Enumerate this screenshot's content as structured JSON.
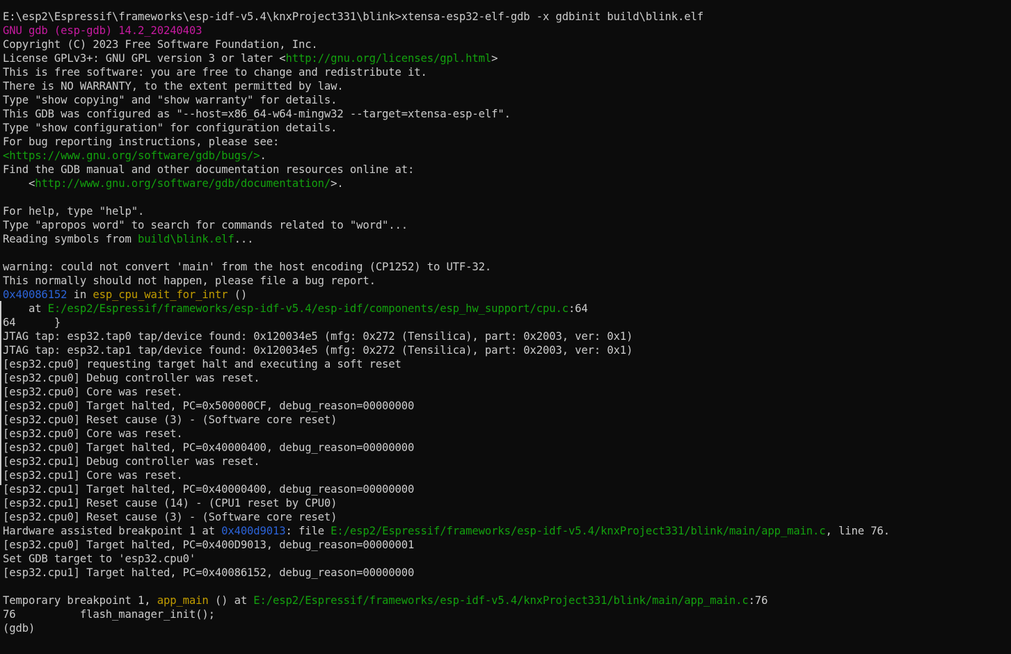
{
  "terminal": {
    "colors": {
      "background": "#0c0c0c",
      "default": "#cccccc",
      "magenta": "#c71aa0",
      "green": "#13a10e",
      "yellow": "#c19c00",
      "blue": "#2b63d8"
    },
    "lines": [
      [
        {
          "t": "E:\\esp2\\Espressif\\frameworks\\esp-idf-v5.4\\knxProject331\\blink>xtensa-esp32-elf-gdb -x gdbinit build\\blink.elf",
          "c": "default"
        }
      ],
      [
        {
          "t": "GNU gdb (esp-gdb) 14.2_20240403",
          "c": "magenta"
        }
      ],
      [
        {
          "t": "Copyright (C) 2023 Free Software Foundation, Inc.",
          "c": "default"
        }
      ],
      [
        {
          "t": "License GPLv3+: GNU GPL version 3 or later <",
          "c": "default"
        },
        {
          "t": "http://gnu.org/licenses/gpl.html",
          "c": "green"
        },
        {
          "t": ">",
          "c": "default"
        }
      ],
      [
        {
          "t": "This is free software: you are free to change and redistribute it.",
          "c": "default"
        }
      ],
      [
        {
          "t": "There is NO WARRANTY, to the extent permitted by law.",
          "c": "default"
        }
      ],
      [
        {
          "t": "Type \"show copying\" and \"show warranty\" for details.",
          "c": "default"
        }
      ],
      [
        {
          "t": "This GDB was configured as \"--host=x86_64-w64-mingw32 --target=xtensa-esp-elf\".",
          "c": "default"
        }
      ],
      [
        {
          "t": "Type \"show configuration\" for configuration details.",
          "c": "default"
        }
      ],
      [
        {
          "t": "For bug reporting instructions, please see:",
          "c": "default"
        }
      ],
      [
        {
          "t": "<https://www.gnu.org/software/gdb/bugs/>",
          "c": "green"
        },
        {
          "t": ".",
          "c": "default"
        }
      ],
      [
        {
          "t": "Find the GDB manual and other documentation resources online at:",
          "c": "default"
        }
      ],
      [
        {
          "t": "    <",
          "c": "default"
        },
        {
          "t": "http://www.gnu.org/software/gdb/documentation/",
          "c": "green"
        },
        {
          "t": ">.",
          "c": "default"
        }
      ],
      [],
      [
        {
          "t": "For help, type \"help\".",
          "c": "default"
        }
      ],
      [
        {
          "t": "Type \"apropos word\" to search for commands related to \"word\"...",
          "c": "default"
        }
      ],
      [
        {
          "t": "Reading symbols from ",
          "c": "default"
        },
        {
          "t": "build\\blink.elf",
          "c": "green"
        },
        {
          "t": "...",
          "c": "default"
        }
      ],
      [],
      [
        {
          "t": "warning: could not convert 'main' from the host encoding (CP1252) to UTF-32.",
          "c": "default"
        }
      ],
      [
        {
          "t": "This normally should not happen, please file a bug report.",
          "c": "default"
        }
      ],
      [
        {
          "t": "0x40086152",
          "c": "blue"
        },
        {
          "t": " in ",
          "c": "default"
        },
        {
          "t": "esp_cpu_wait_for_intr",
          "c": "yellow"
        },
        {
          "t": " ()",
          "c": "default"
        }
      ],
      [
        {
          "t": "    at ",
          "c": "default"
        },
        {
          "t": "E:/esp2/Espressif/frameworks/esp-idf-v5.4/esp-idf/components/esp_hw_support/cpu.c",
          "c": "green"
        },
        {
          "t": ":64",
          "c": "default"
        }
      ],
      [
        {
          "t": "64      }",
          "c": "default"
        }
      ],
      [
        {
          "t": "JTAG tap: esp32.tap0 tap/device found: 0x120034e5 (mfg: 0x272 (Tensilica), part: 0x2003, ver: 0x1)",
          "c": "default"
        }
      ],
      [
        {
          "t": "JTAG tap: esp32.tap1 tap/device found: 0x120034e5 (mfg: 0x272 (Tensilica), part: 0x2003, ver: 0x1)",
          "c": "default"
        }
      ],
      [
        {
          "t": "[esp32.cpu0] requesting target halt and executing a soft reset",
          "c": "default"
        }
      ],
      [
        {
          "t": "[esp32.cpu0] Debug controller was reset.",
          "c": "default"
        }
      ],
      [
        {
          "t": "[esp32.cpu0] Core was reset.",
          "c": "default"
        }
      ],
      [
        {
          "t": "[esp32.cpu0] Target halted, PC=0x500000CF, debug_reason=00000000",
          "c": "default"
        }
      ],
      [
        {
          "t": "[esp32.cpu0] Reset cause (3) - (Software core reset)",
          "c": "default"
        }
      ],
      [
        {
          "t": "[esp32.cpu0] Core was reset.",
          "c": "default"
        }
      ],
      [
        {
          "t": "[esp32.cpu0] Target halted, PC=0x40000400, debug_reason=00000000",
          "c": "default"
        }
      ],
      [
        {
          "t": "[esp32.cpu1] Debug controller was reset.",
          "c": "default"
        }
      ],
      [
        {
          "t": "[esp32.cpu1] Core was reset.",
          "c": "default"
        }
      ],
      [
        {
          "t": "[esp32.cpu1] Target halted, PC=0x40000400, debug_reason=00000000",
          "c": "default"
        }
      ],
      [
        {
          "t": "[esp32.cpu1] Reset cause (14) - (CPU1 reset by CPU0)",
          "c": "default"
        }
      ],
      [
        {
          "t": "[esp32.cpu0] Reset cause (3) - (Software core reset)",
          "c": "default"
        }
      ],
      [
        {
          "t": "Hardware assisted breakpoint 1 at ",
          "c": "default"
        },
        {
          "t": "0x400d9013",
          "c": "blue"
        },
        {
          "t": ": file ",
          "c": "default"
        },
        {
          "t": "E:/esp2/Espressif/frameworks/esp-idf-v5.4/knxProject331/blink/main/app_main.c",
          "c": "green"
        },
        {
          "t": ", line 76.",
          "c": "default"
        }
      ],
      [
        {
          "t": "[esp32.cpu0] Target halted, PC=0x400D9013, debug_reason=00000001",
          "c": "default"
        }
      ],
      [
        {
          "t": "Set GDB target to 'esp32.cpu0'",
          "c": "default"
        }
      ],
      [
        {
          "t": "[esp32.cpu1] Target halted, PC=0x40086152, debug_reason=00000000",
          "c": "default"
        }
      ],
      [],
      [
        {
          "t": "Temporary breakpoint 1, ",
          "c": "default"
        },
        {
          "t": "app_main",
          "c": "yellow"
        },
        {
          "t": " () at ",
          "c": "default"
        },
        {
          "t": "E:/esp2/Espressif/frameworks/esp-idf-v5.4/knxProject331/blink/main/app_main.c",
          "c": "green"
        },
        {
          "t": ":76",
          "c": "default"
        }
      ],
      [
        {
          "t": "76          flash_manager_init();",
          "c": "default"
        }
      ],
      [
        {
          "t": "(gdb)",
          "c": "default"
        }
      ]
    ]
  }
}
